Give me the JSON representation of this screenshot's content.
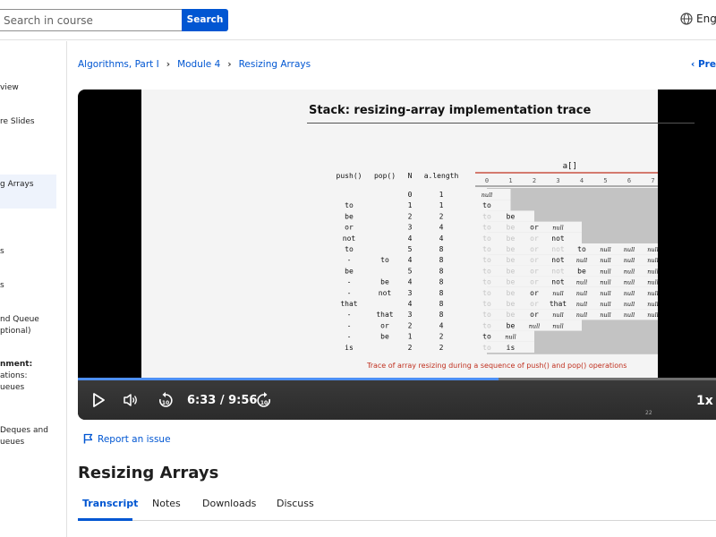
{
  "header": {
    "search_placeholder": "Search in course",
    "search_button": "Search",
    "language": "Engl"
  },
  "sidebar": {
    "items": [
      {
        "lines": [
          "view"
        ]
      },
      {
        "lines": [
          "re Slides"
        ]
      },
      {
        "lines": [
          "g Arrays"
        ],
        "active": true
      },
      {
        "lines": [
          "s"
        ]
      },
      {
        "lines": [
          "s"
        ]
      },
      {
        "lines": [
          "nd Queue",
          "ptional)"
        ]
      },
      {
        "lines": [
          "nment:",
          "ations:",
          "ueues"
        ],
        "bold_first": true
      },
      {
        "lines": [
          "Deques and",
          "ueues"
        ]
      }
    ]
  },
  "breadcrumb": [
    "Algorithms, Part I",
    "Module 4",
    "Resizing Arrays"
  ],
  "prev_label": "Prev",
  "video": {
    "slide_title": "Stack:  resizing-array implementation trace",
    "slide_caption": "Trace of array resizing during a sequence of push() and pop() operations",
    "slide_number": "22",
    "array_header": "a[]",
    "columns": [
      "push()",
      "pop()",
      "N",
      "a.length"
    ],
    "indices": [
      "0",
      "1",
      "2",
      "3",
      "4",
      "5",
      "6",
      "7"
    ],
    "rows": [
      {
        "push": "",
        "pop": "",
        "n": "0",
        "len": "1",
        "cells": [
          "null"
        ]
      },
      {
        "push": "to",
        "pop": "",
        "n": "1",
        "len": "1",
        "cells": [
          "to"
        ]
      },
      {
        "push": "be",
        "pop": "",
        "n": "2",
        "len": "2",
        "cells": [
          "to",
          "be"
        ]
      },
      {
        "push": "or",
        "pop": "",
        "n": "3",
        "len": "4",
        "cells": [
          "to",
          "be",
          "or",
          "null"
        ]
      },
      {
        "push": "not",
        "pop": "",
        "n": "4",
        "len": "4",
        "cells": [
          "to",
          "be",
          "or",
          "not"
        ]
      },
      {
        "push": "to",
        "pop": "",
        "n": "5",
        "len": "8",
        "cells": [
          "to",
          "be",
          "or",
          "not",
          "to",
          "null",
          "null",
          "null"
        ]
      },
      {
        "push": "-",
        "pop": "to",
        "n": "4",
        "len": "8",
        "cells": [
          "to",
          "be",
          "or",
          "not",
          "null",
          "null",
          "null",
          "null"
        ]
      },
      {
        "push": "be",
        "pop": "",
        "n": "5",
        "len": "8",
        "cells": [
          "to",
          "be",
          "or",
          "not",
          "be",
          "null",
          "null",
          "null"
        ]
      },
      {
        "push": "-",
        "pop": "be",
        "n": "4",
        "len": "8",
        "cells": [
          "to",
          "be",
          "or",
          "not",
          "null",
          "null",
          "null",
          "null"
        ]
      },
      {
        "push": "-",
        "pop": "not",
        "n": "3",
        "len": "8",
        "cells": [
          "to",
          "be",
          "or",
          "null",
          "null",
          "null",
          "null",
          "null"
        ]
      },
      {
        "push": "that",
        "pop": "",
        "n": "4",
        "len": "8",
        "cells": [
          "to",
          "be",
          "or",
          "that",
          "null",
          "null",
          "null",
          "null"
        ]
      },
      {
        "push": "-",
        "pop": "that",
        "n": "3",
        "len": "8",
        "cells": [
          "to",
          "be",
          "or",
          "null",
          "null",
          "null",
          "null",
          "null"
        ]
      },
      {
        "push": "-",
        "pop": "or",
        "n": "2",
        "len": "4",
        "cells": [
          "to",
          "be",
          "null",
          "null"
        ]
      },
      {
        "push": "-",
        "pop": "be",
        "n": "1",
        "len": "2",
        "cells": [
          "to",
          "null"
        ]
      },
      {
        "push": "is",
        "pop": "",
        "n": "2",
        "len": "2",
        "cells": [
          "to",
          "is"
        ]
      }
    ],
    "time_display": "6:33 / 9:56",
    "progress": 0.6593,
    "speed": "1x",
    "caption_color": "#c0301f"
  },
  "report_issue": "Report an issue",
  "page_title": "Resizing Arrays",
  "tabs": [
    "Transcript",
    "Notes",
    "Downloads",
    "Discuss"
  ],
  "colors": {
    "accent": "#0056d2",
    "progress": "#4d8ff5"
  }
}
